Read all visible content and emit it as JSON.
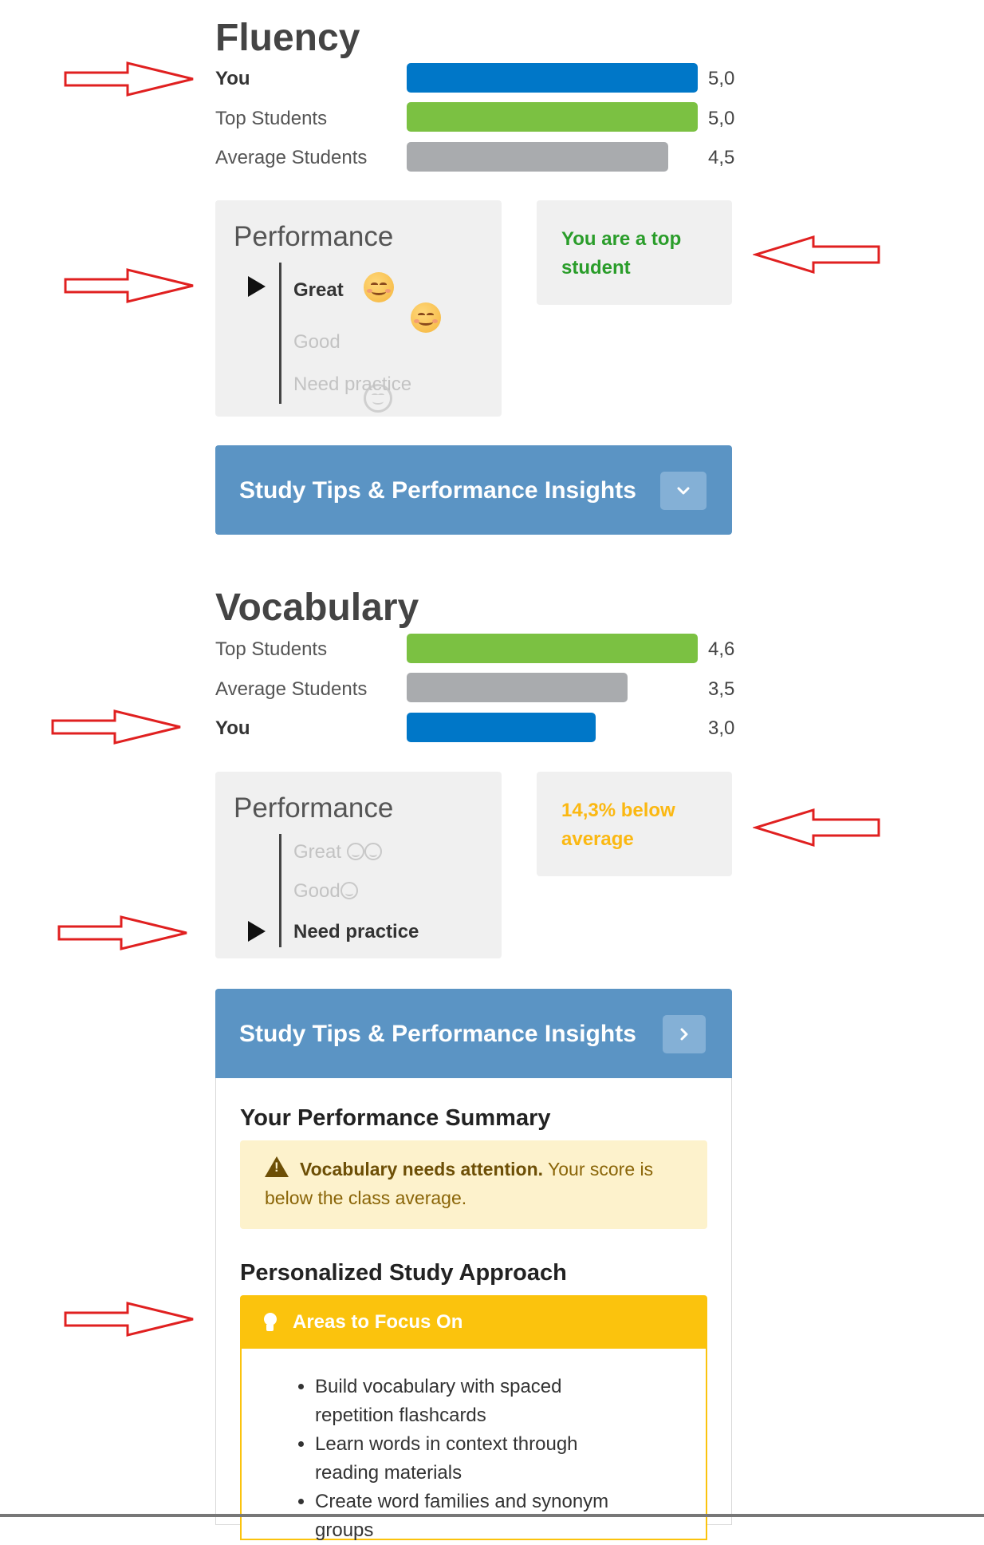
{
  "fluency": {
    "title": "Fluency",
    "rows": [
      {
        "label": "You",
        "value": "5,0",
        "fraction": 1.0,
        "color": "#0077c8"
      },
      {
        "label": "Top Students",
        "value": "5,0",
        "fraction": 1.0,
        "color": "#7bc142"
      },
      {
        "label": "Average Students",
        "value": "4,5",
        "fraction": 0.9,
        "color": "#a9abae"
      }
    ],
    "performance": {
      "title": "Performance",
      "great": "Great",
      "good": "Good",
      "need_practice": "Need practice",
      "active_level": "Great"
    },
    "status": {
      "text": "You are a top student",
      "color": "#2a9d2a"
    },
    "tips": {
      "title": "Study Tips & Performance Insights",
      "toggle_icon": "chevron-down-icon",
      "expanded": false
    }
  },
  "vocabulary": {
    "title": "Vocabulary",
    "rows": [
      {
        "label": "Top Students",
        "value": "4,6",
        "fraction": 1.0,
        "color": "#7bc142"
      },
      {
        "label": "Average Students",
        "value": "3,5",
        "fraction": 0.761,
        "color": "#a9abae"
      },
      {
        "label": "You",
        "value": "3,0",
        "fraction": 0.652,
        "color": "#0077c8"
      }
    ],
    "performance": {
      "title": "Performance",
      "great": "Great",
      "good": "Good",
      "need_practice": "Need practice",
      "active_level": "Need practice"
    },
    "status": {
      "text": "14,3% below average",
      "color": "#fbb812"
    },
    "tips": {
      "title": "Study Tips & Performance Insights",
      "toggle_icon": "chevron-right-icon",
      "expanded": true,
      "summary_heading": "Your Performance Summary",
      "alert_bold": "Vocabulary needs attention.",
      "alert_rest": "Your score is below the class average.",
      "approach_heading": "Personalized Study Approach",
      "focus_title": "Areas to Focus On",
      "focus_items": [
        "Build vocabulary with spaced repetition flashcards",
        "Learn words in context through reading materials",
        "Create word families and synonym groups"
      ]
    }
  },
  "colors": {
    "annotation_arrow": "#e02020",
    "tips_header": "#5b94c4"
  }
}
